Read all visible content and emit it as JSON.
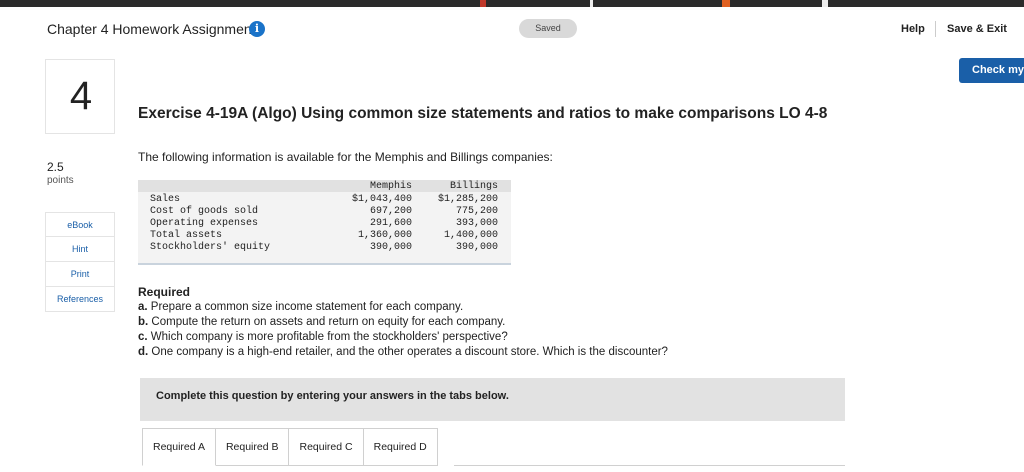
{
  "header": {
    "title": "Chapter 4 Homework Assignment",
    "info_icon": "info-icon",
    "saved": "Saved",
    "help": "Help",
    "save_exit": "Save & Exit",
    "check_my": "Check my"
  },
  "question": {
    "number": "4",
    "points_value": "2.5",
    "points_label": "points"
  },
  "side_nav": [
    "eBook",
    "Hint",
    "Print",
    "References"
  ],
  "exercise": {
    "title": "Exercise 4-19A (Algo) Using common size statements and ratios to make comparisons LO 4-8",
    "intro": "The following information is available for the Memphis and Billings companies:"
  },
  "table": {
    "columns": [
      "Memphis",
      "Billings"
    ],
    "rows": [
      {
        "label": "Sales",
        "memphis": "$1,043,400",
        "billings": "$1,285,200"
      },
      {
        "label": "Cost of goods sold",
        "memphis": "697,200",
        "billings": "775,200"
      },
      {
        "label": "Operating expenses",
        "memphis": "291,600",
        "billings": "393,000"
      },
      {
        "label": "Total assets",
        "memphis": "1,360,000",
        "billings": "1,400,000"
      },
      {
        "label": "Stockholders' equity",
        "memphis": "390,000",
        "billings": "390,000"
      }
    ]
  },
  "required": {
    "heading": "Required",
    "items": [
      {
        "key": "a.",
        "text": " Prepare a common size income statement for each company."
      },
      {
        "key": "b.",
        "text": " Compute the return on assets and return on equity for each company."
      },
      {
        "key": "c.",
        "text": " Which company is more profitable from the stockholders' perspective?"
      },
      {
        "key": "d.",
        "text": " One company is a high-end retailer, and the other operates a discount store. Which is the discounter?"
      }
    ]
  },
  "instructions": "Complete this question by entering your answers in the tabs below.",
  "tabs": [
    "Required A",
    "Required B",
    "Required C",
    "Required D"
  ],
  "colors": {
    "accent_blue": "#1a5fa8",
    "info_blue": "#1a73c9",
    "panel_gray": "#e2e2e2"
  }
}
